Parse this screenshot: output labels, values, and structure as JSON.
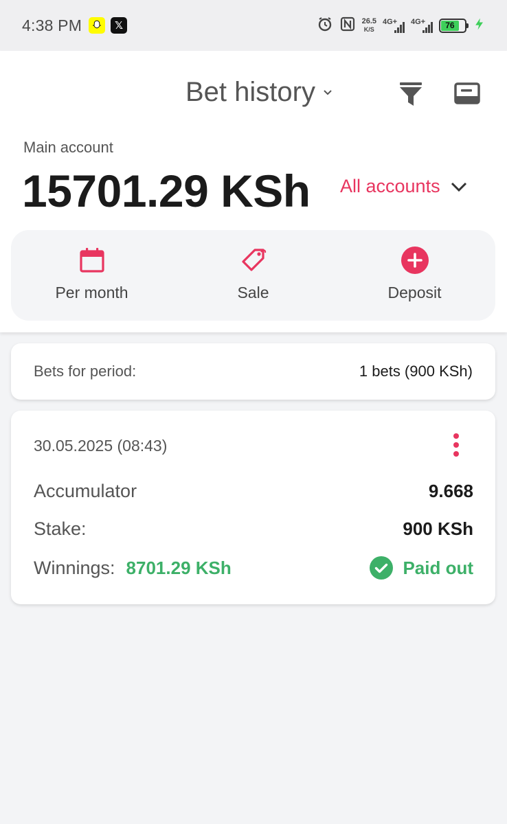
{
  "status_bar": {
    "time": "4:38 PM",
    "speed_value": "26.5",
    "speed_unit": "K/S",
    "network1": "4G+",
    "network2": "4G+",
    "battery": "76"
  },
  "header": {
    "title": "Bet history"
  },
  "account": {
    "label": "Main account",
    "balance": "15701.29 KSh",
    "all_accounts": "All accounts"
  },
  "actions": [
    {
      "label": "Per month",
      "icon": "calendar-icon"
    },
    {
      "label": "Sale",
      "icon": "tag-icon"
    },
    {
      "label": "Deposit",
      "icon": "plus-circle-icon"
    }
  ],
  "period": {
    "label": "Bets for period:",
    "value": "1 bets (900 KSh)"
  },
  "bet": {
    "date": "30.05.2025 (08:43)",
    "type_label": "Accumulator",
    "odds": "9.668",
    "stake_label": "Stake:",
    "stake": "900 KSh",
    "winnings_label": "Winnings:",
    "winnings": "8701.29 KSh",
    "status": "Paid out"
  },
  "colors": {
    "accent": "#e8355f",
    "success": "#3db068",
    "background": "#f3f4f6"
  }
}
